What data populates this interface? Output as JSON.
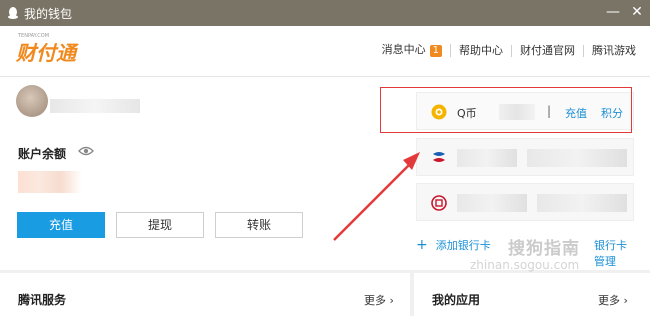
{
  "window": {
    "title": "我的钱包",
    "minimize": "—",
    "close": "✕"
  },
  "header": {
    "logo_main": "财付通",
    "logo_tiny": "TENPAY.COM",
    "nav": [
      {
        "label": "消息中心",
        "badge": "1"
      },
      {
        "label": "帮助中心"
      },
      {
        "label": "财付通官网"
      },
      {
        "label": "腾讯游戏"
      }
    ]
  },
  "account": {
    "balance_label": "账户余额",
    "buttons": {
      "recharge": "充值",
      "withdraw": "提现",
      "transfer": "转账"
    }
  },
  "side": {
    "qcoin": {
      "label": "Q币",
      "separator": "|",
      "recharge": "充值",
      "points": "积分"
    },
    "add_bank": "添加银行卡",
    "manage_bank": "银行卡管理"
  },
  "sections": {
    "tencent_services": {
      "title": "腾讯服务",
      "more": "更多"
    },
    "my_apps": {
      "title": "我的应用",
      "more": "更多"
    }
  },
  "watermark": {
    "text": "搜狗指南",
    "url": "zhinan.sogou.com"
  },
  "colors": {
    "accent": "#1a9ce3",
    "brand_orange": "#f08a1e",
    "highlight_red": "#e23a3a"
  }
}
